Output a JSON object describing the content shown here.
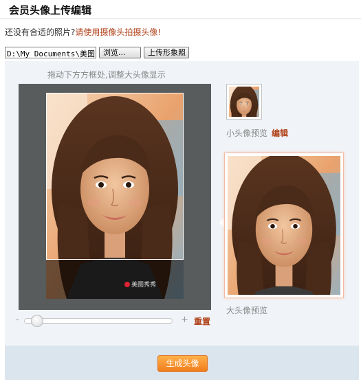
{
  "page": {
    "title": "会员头像上传编辑"
  },
  "hint": {
    "text": "还没有合适的照片?",
    "link": "请使用摄像头拍摄头像!"
  },
  "upload": {
    "file_value": "D:\\My Documents\\美图",
    "browse_label": "浏览...",
    "upload_label": "上传形象照"
  },
  "editor": {
    "drag_hint": "拖动下方方框处,调整大头像显示",
    "reset_label": "重置",
    "zoom_minus": "-",
    "zoom_plus": "+",
    "zoom_level": 0.05,
    "watermark": "美图秀秀"
  },
  "preview": {
    "small_label": "小头像预览",
    "edit_label": "编辑",
    "big_label": "大头像预览"
  },
  "footer": {
    "generate_label": "生成头像"
  },
  "colors": {
    "accent_link": "#b0421a",
    "button_orange": "#f07e1e",
    "crop_bg": "#585c5c",
    "panel_bg": "#f0f4f8",
    "footer_bg": "#dbe5ee"
  }
}
